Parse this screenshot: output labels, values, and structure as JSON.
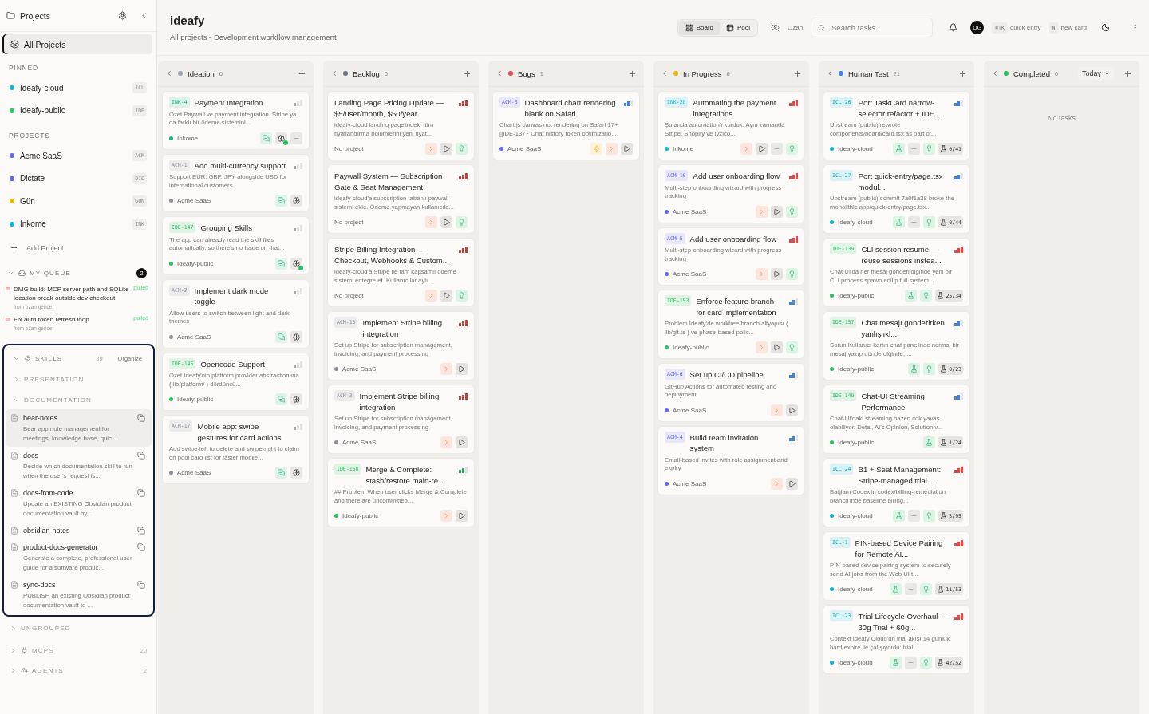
{
  "sidebar": {
    "title": "Projects",
    "all_projects": {
      "label": "All Projects",
      "selected": true
    },
    "pinned": {
      "label": "PINNED",
      "items": [
        {
          "name": "Ideafy-cloud",
          "code": "ICL",
          "color": "#06b6d4"
        },
        {
          "name": "Ideafy-public",
          "code": "IDE",
          "color": "#22c55e"
        }
      ]
    },
    "projects": {
      "label": "PROJECTS",
      "items": [
        {
          "name": "Acme SaaS",
          "code": "ACM",
          "color": "#6366f1"
        },
        {
          "name": "Dictate",
          "code": "DIC",
          "color": "#5b5fd6"
        },
        {
          "name": "Gün",
          "code": "GUN",
          "color": "#eab308"
        },
        {
          "name": "Inkome",
          "code": "INK",
          "color": "#06b6d4"
        }
      ]
    },
    "add_project": "Add Project",
    "queue": {
      "label": "MY QUEUE",
      "count": "2",
      "expanded": true,
      "items": [
        {
          "flag": "!!!",
          "title": "DMG build: MCP server path and SQLite location break outside dev checkout",
          "from": "from ozan gencer",
          "status": "pulled"
        },
        {
          "flag": "!!!",
          "title": "Fix auth token refresh loop",
          "from": "from ozan gencer",
          "status": "pulled"
        }
      ]
    },
    "skills": {
      "label": "SKILLS",
      "count": "39",
      "action": "Organize",
      "expanded": true,
      "groups": [
        {
          "label": "PRESENTATION",
          "expanded": false
        },
        {
          "label": "DOCUMENTATION",
          "expanded": true,
          "items": [
            {
              "name": "bear-notes",
              "desc": "Bear app note management for meetings, knowledge base, quic...",
              "selected": true
            },
            {
              "name": "docs",
              "desc": "Decide which documentation skill to run when the user's request is...",
              "selected": false
            },
            {
              "name": "docs-from-code",
              "desc": "Update an EXISTING Obsidian product documentation vault by...",
              "selected": false
            },
            {
              "name": "obsidian-notes",
              "selected": false
            },
            {
              "name": "product-docs-generator",
              "desc": "Generate a complete, professional user guide for a software produc...",
              "selected": false
            },
            {
              "name": "sync-docs",
              "desc": "PUBLISH an existing Obsidian product documentation vault to ...",
              "selected": false
            }
          ]
        }
      ]
    },
    "sections": [
      {
        "label": "UNGROUPED",
        "kind": "group",
        "expanded": false
      },
      {
        "label": "MCPS",
        "kind": "mcp",
        "count": "20",
        "expanded": false
      },
      {
        "label": "AGENTS",
        "kind": "agent",
        "count": "2",
        "expanded": false
      }
    ]
  },
  "header": {
    "title": "ideafy",
    "subtitle": "All projects - Development workflow management",
    "views": [
      {
        "label": "Board",
        "kind": "board",
        "selected": true
      },
      {
        "label": "Pool",
        "kind": "pool",
        "selected": false
      }
    ],
    "user_filter": "Ozan",
    "search": {
      "placeholder": "Search tasks..."
    },
    "avatar": "OG",
    "shortcuts": [
      {
        "key": "⌘⇧K",
        "label": "quick entry"
      },
      {
        "key": "N",
        "label": "new card"
      }
    ]
  },
  "columns": [
    {
      "name": "Ideation",
      "count": "6",
      "color": "#9ca3af",
      "cards": [
        {
          "id": "INK-4",
          "title": "Payment Integration",
          "desc": "Özet Paywall ve payment integration. Stripe ya da farklı bir ödeme sistemini...",
          "project": "Inkome",
          "color": "#10b981",
          "priority": {
            "level": 0.33,
            "color": "#a3a3a3"
          },
          "actions": [
            {
              "kind": "chat"
            },
            {
              "kind": "agent-running"
            },
            {
              "kind": "pin"
            }
          ]
        },
        {
          "id": "ACM-1",
          "title": "Add multi-currency support",
          "desc": "Support EUR, GBP, JPY alongside USD for international customers",
          "project": "Acme SaaS",
          "color": "#8b8f99",
          "priority": {
            "level": 0.33,
            "color": "#a3a3a3"
          },
          "actions": [
            {
              "kind": "chat"
            },
            {
              "kind": "agent"
            }
          ]
        },
        {
          "id": "IDE-147",
          "title": "Grouping Skills",
          "desc": "The app can already read the skill files automatically, so there's no issue on that...",
          "project": "Ideafy-public",
          "color": "#22c55e",
          "priority": {
            "level": 0.33,
            "color": "#a3a3a3"
          },
          "actions": [
            {
              "kind": "chat"
            },
            {
              "kind": "agent-running"
            }
          ]
        },
        {
          "id": "ACM-2",
          "title": "Implement dark mode toggle",
          "desc": "Allow users to switch between light and dark themes",
          "project": "Acme SaaS",
          "color": "#8b8f99",
          "priority": {
            "level": 0.33,
            "color": "#a3a3a3"
          },
          "actions": [
            {
              "kind": "chat"
            },
            {
              "kind": "agent"
            }
          ]
        },
        {
          "id": "IDE-145",
          "title": "Opencode Support",
          "desc": "Özet Ideafy'nin platform provider abstraction'ına ( lib/platform/ ) dördüncü...",
          "project": "Ideafy-public",
          "color": "#22c55e",
          "priority": {
            "level": 0.33,
            "color": "#a3a3a3"
          },
          "actions": [
            {
              "kind": "chat"
            },
            {
              "kind": "agent"
            }
          ]
        },
        {
          "id": "ACM-17",
          "title": "Mobile app: swipe gestures for card actions",
          "desc": "Add swipe-left to delete and swipe-right to claim on pool card list for faster mobile...",
          "project": "Acme SaaS",
          "color": "#8b8f99",
          "priority": {
            "level": 0.33,
            "color": "#a3a3a3"
          },
          "actions": [
            {
              "kind": "chat"
            },
            {
              "kind": "agent"
            }
          ]
        }
      ]
    },
    {
      "name": "Backlog",
      "count": "6",
      "color": "#6b7280",
      "cards": [
        {
          "title": "Landing Page Pricing Update — $5/user/month, $50/year",
          "desc": "ideafy-cloud landing page'indeki tüm fiyatlandırma bölümlerini yeni fiyat...",
          "project": "No project",
          "priority": {
            "level": 1,
            "color": "#c2413a"
          },
          "actions": [
            {
              "kind": "terminal"
            },
            {
              "kind": "play"
            },
            {
              "kind": "idea"
            }
          ]
        },
        {
          "title": "Paywall System — Subscription Gate & Seat Management",
          "desc": "ideafy-cloud'a subscription tabanlı paywall sistemi ekle. Ödeme yapmayan kullanıcıla...",
          "project": "No project",
          "priority": {
            "level": 1,
            "color": "#c2413a"
          },
          "actions": [
            {
              "kind": "terminal"
            },
            {
              "kind": "play"
            },
            {
              "kind": "idea"
            }
          ]
        },
        {
          "title": "Stripe Billing Integration — Checkout, Webhooks & Custom...",
          "desc": "ideafy-cloud'a Stripe ile tam kapsamlı ödeme sistemi entegre et. Kullanıcılar aylı...",
          "project": "No project",
          "priority": {
            "level": 1,
            "color": "#c2413a"
          },
          "actions": [
            {
              "kind": "terminal"
            },
            {
              "kind": "play"
            },
            {
              "kind": "idea"
            }
          ]
        },
        {
          "id": "ACM-15",
          "title": "Implement Stripe billing integration",
          "desc": "Set up Stripe for subscription management, invoicing, and payment processing",
          "project": "Acme SaaS",
          "color": "#8b8f99",
          "priority": {
            "level": 1,
            "color": "#c2413a"
          },
          "actions": [
            {
              "kind": "terminal"
            },
            {
              "kind": "play"
            }
          ]
        },
        {
          "id": "ACM-3",
          "title": "Implement Stripe billing integration",
          "desc": "Set up Stripe for subscription management, invoicing, and payment processing",
          "project": "Acme SaaS",
          "color": "#8b8f99",
          "priority": {
            "level": 1,
            "color": "#c2413a"
          },
          "actions": [
            {
              "kind": "terminal"
            },
            {
              "kind": "play"
            }
          ]
        },
        {
          "id": "IDE-158",
          "title": "Merge & Complete: stash/restore main-re...",
          "desc": "## Problem When user clicks Merge & Complete and there are uncommitted...",
          "project": "Ideafy-public",
          "color": "#22c55e",
          "priority": {
            "level": 0.67,
            "color": "#22a35a"
          },
          "actions": [
            {
              "kind": "terminal"
            },
            {
              "kind": "play"
            }
          ]
        }
      ]
    },
    {
      "name": "Bugs",
      "count": "1",
      "color": "#ef4444",
      "cards": [
        {
          "id": "ACM-8",
          "title": "Dashboard chart rendering blank on Safari",
          "desc": "Chart.js canvas not rendering on Safari 17+ [[IDE-137 · Chat history token optimizatio...",
          "project": "Acme SaaS",
          "color": "#6366f1",
          "priority": {
            "level": 0.67,
            "color": "#3b82f6"
          },
          "actions": [
            {
              "kind": "bolt"
            },
            {
              "kind": "terminal"
            },
            {
              "kind": "play"
            }
          ]
        }
      ]
    },
    {
      "name": "In Progress",
      "count": "6",
      "color": "#eab308",
      "cards": [
        {
          "id": "INK-28",
          "title": "Automating the payment integrations",
          "desc": "Şu anda automation'ı kurduk. Aynı zamanda Stripe, Shopify ve Iyzico...",
          "project": "Inkome",
          "color": "#06b6d4",
          "priority": {
            "level": 1,
            "color": "#ef4444"
          },
          "actions": [
            {
              "kind": "terminal"
            },
            {
              "kind": "play"
            },
            {
              "kind": "pin"
            },
            {
              "kind": "idea"
            }
          ]
        },
        {
          "id": "ACM-16",
          "title": "Add user onboarding flow",
          "desc": "Multi-step onboarding wizard with progress tracking",
          "project": "Acme SaaS",
          "color": "#6366f1",
          "priority": {
            "level": 1,
            "color": "#ef4444"
          },
          "actions": [
            {
              "kind": "terminal"
            },
            {
              "kind": "play"
            },
            {
              "kind": "idea"
            }
          ]
        },
        {
          "id": "ACM-5",
          "title": "Add user onboarding flow",
          "desc": "Multi-step onboarding wizard with progress tracking",
          "project": "Acme SaaS",
          "color": "#6366f1",
          "priority": {
            "level": 1,
            "color": "#ef4444"
          },
          "actions": [
            {
              "kind": "terminal"
            },
            {
              "kind": "play"
            },
            {
              "kind": "idea"
            }
          ]
        },
        {
          "id": "IDE-153",
          "title": "Enforce feature branch for card implementation",
          "desc": "Problem Ideafy'de worktree/branch altyapısı ( lib/git.ts ) ve phase-based polic...",
          "project": "Ideafy-public",
          "color": "#22c55e",
          "priority": {
            "level": 0.67,
            "color": "#3b82f6"
          },
          "actions": [
            {
              "kind": "terminal"
            },
            {
              "kind": "play"
            },
            {
              "kind": "idea"
            }
          ]
        },
        {
          "id": "ACM-6",
          "title": "Set up CI/CD pipeline",
          "desc": "GitHub Actions for automated testing and deployment",
          "project": "Acme SaaS",
          "color": "#6366f1",
          "priority": {
            "level": 0.67,
            "color": "#3b82f6"
          },
          "actions": [
            {
              "kind": "terminal"
            },
            {
              "kind": "play"
            }
          ]
        },
        {
          "id": "ACM-4",
          "title": "Build team invitation system",
          "desc": "Email-based invites with role assignment and expiry",
          "project": "Acme SaaS",
          "color": "#6366f1",
          "priority": {
            "level": 0.67,
            "color": "#3b82f6"
          },
          "actions": [
            {
              "kind": "terminal"
            },
            {
              "kind": "play"
            }
          ]
        }
      ]
    },
    {
      "name": "Human Test",
      "count": "21",
      "color": "#3b82f6",
      "cards": [
        {
          "id": "ICL-26",
          "title": "Port TaskCard narrow-selector refactor + IDE...",
          "desc": "Upstream (public) rewrote components/board/card.tsx as part of...",
          "project": "Ideafy-cloud",
          "color": "#06b6d4",
          "priority": {
            "level": 0.67,
            "color": "#3b82f6"
          },
          "actions": [
            {
              "kind": "test"
            },
            {
              "kind": "pin"
            },
            {
              "kind": "idea"
            },
            {
              "kind": "count",
              "text": "0/41"
            }
          ]
        },
        {
          "id": "ICL-27",
          "title": "Port quick-entry/page.tsx modul...",
          "desc": "Upstream (public) commit 7a0f1a38 broke the monolithic app/quick-entry/page.tsx...",
          "project": "Ideafy-cloud",
          "color": "#06b6d4",
          "priority": {
            "level": 0.67,
            "color": "#3b82f6"
          },
          "actions": [
            {
              "kind": "test"
            },
            {
              "kind": "pin"
            },
            {
              "kind": "idea"
            },
            {
              "kind": "count",
              "text": "0/44"
            }
          ]
        },
        {
          "id": "IDE-139",
          "title": "CLI session resume — reuse sessions instea...",
          "desc": "Chat UI'da her mesaj gönderildiğinde yeni bir CLI process spawn edilip full system...",
          "project": "Ideafy-public",
          "color": "#22c55e",
          "priority": {
            "level": 1,
            "color": "#ef4444"
          },
          "actions": [
            {
              "kind": "test"
            },
            {
              "kind": "idea"
            },
            {
              "kind": "count",
              "text": "25/34"
            }
          ]
        },
        {
          "id": "IDE-157",
          "title": "Chat mesajı gönderirken yanlışlıkl...",
          "desc": "Sorun Kullanıcı kartın chat panelinde normal bir mesaj yazıp gönderdiğinde, ...",
          "project": "Ideafy-public",
          "color": "#22c55e",
          "priority": {
            "level": 0.67,
            "color": "#3b82f6"
          },
          "actions": [
            {
              "kind": "test"
            },
            {
              "kind": "idea"
            },
            {
              "kind": "count",
              "text": "0/23"
            }
          ]
        },
        {
          "id": "IDE-149",
          "title": "Chat-UI Streaming Performance",
          "desc": "Chat-UI'daki streaming bazen çok yavaş olabiliyor. Detai, AI's Opinion, Solution v...",
          "project": "Ideafy-public",
          "color": "#22c55e",
          "priority": {
            "level": 0.67,
            "color": "#3b82f6"
          },
          "actions": [
            {
              "kind": "test"
            },
            {
              "kind": "count",
              "text": "1/24"
            }
          ]
        },
        {
          "id": "ICL-24",
          "title": "B1 + Seat Management: Stripe-managed trial ...",
          "desc": "Bağlam Codex'in codex/billing-remediation branch'inde baseline billing...",
          "project": "Ideafy-cloud",
          "color": "#06b6d4",
          "priority": {
            "level": 1,
            "color": "#ef4444"
          },
          "actions": [
            {
              "kind": "test"
            },
            {
              "kind": "pin"
            },
            {
              "kind": "idea"
            },
            {
              "kind": "count",
              "text": "3/95"
            }
          ]
        },
        {
          "id": "ICL-1",
          "title": "PIN-based Device Pairing for Remote AI...",
          "desc": "PIN-based device pairing system to securely send AI jobs from the Web UI t...",
          "project": "Ideafy-cloud",
          "color": "#06b6d4",
          "priority": {
            "level": 1,
            "color": "#ef4444"
          },
          "actions": [
            {
              "kind": "test"
            },
            {
              "kind": "pin"
            },
            {
              "kind": "idea"
            },
            {
              "kind": "count",
              "text": "11/53"
            }
          ]
        },
        {
          "id": "ICL-23",
          "title": "Trial Lifecycle Overhaul — 30g Trial + 60g...",
          "desc": "Context Ideafy Cloud'un trial akışı 14 günlük hard expire ile çalışıyordu: trial...",
          "project": "Ideafy-cloud",
          "color": "#06b6d4",
          "priority": {
            "level": 1,
            "color": "#ef4444"
          },
          "actions": [
            {
              "kind": "test"
            },
            {
              "kind": "pin"
            },
            {
              "kind": "idea"
            },
            {
              "kind": "count",
              "text": "42/52"
            }
          ]
        }
      ]
    },
    {
      "name": "Completed",
      "count": "0",
      "color": "#22c55e",
      "filter": "Today",
      "empty": "No tasks"
    }
  ]
}
